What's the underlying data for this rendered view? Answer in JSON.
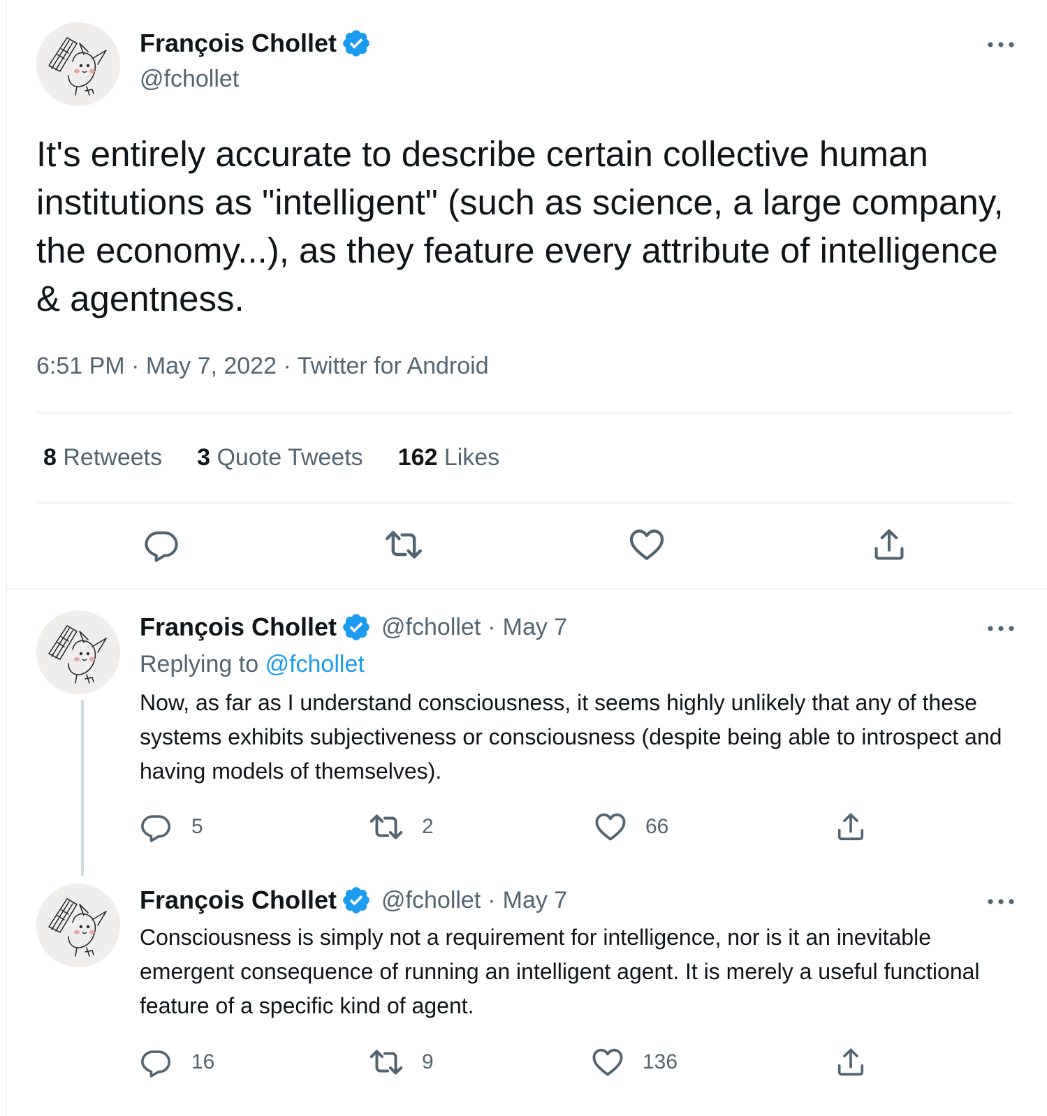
{
  "main_tweet": {
    "author": {
      "name": "François Chollet",
      "handle": "@fchollet",
      "verified": true
    },
    "text": "It's entirely accurate to describe certain collective human institutions as \"intelligent\" (such as science, a large company, the economy...), as they feature every attribute of intelligence & agentness.",
    "time": "6:51 PM",
    "date": "May 7, 2022",
    "source": "Twitter for Android",
    "separator": "·",
    "stats": {
      "retweets": {
        "count": "8",
        "label": "Retweets"
      },
      "quotes": {
        "count": "3",
        "label": "Quote Tweets"
      },
      "likes": {
        "count": "162",
        "label": "Likes"
      }
    },
    "actions": [
      "reply-icon",
      "retweet-icon",
      "like-icon",
      "share-icon"
    ]
  },
  "replies": [
    {
      "author": {
        "name": "François Chollet",
        "handle": "@fchollet",
        "verified": true
      },
      "date_sep": "·",
      "date": "May 7",
      "replying_prefix": "Replying to",
      "replying_to": "@fchollet",
      "text": "Now, as far as I understand consciousness, it seems highly unlikely that any of these systems exhibits subjectiveness or consciousness (despite being able to introspect and having models of themselves).",
      "counts": {
        "replies": "5",
        "retweets": "2",
        "likes": "66"
      }
    },
    {
      "author": {
        "name": "François Chollet",
        "handle": "@fchollet",
        "verified": true
      },
      "date_sep": "·",
      "date": "May 7",
      "text": "Consciousness is simply not a requirement for intelligence, nor is it an inevitable emergent consequence of running an intelligent agent. It is merely a useful functional feature of a specific kind of agent.",
      "counts": {
        "replies": "16",
        "retweets": "9",
        "likes": "136"
      }
    }
  ],
  "colors": {
    "text": "#0f1419",
    "secondary": "#536471",
    "accent": "#1d9bf0",
    "border": "#eff3f4",
    "thread": "#cfd9de"
  }
}
